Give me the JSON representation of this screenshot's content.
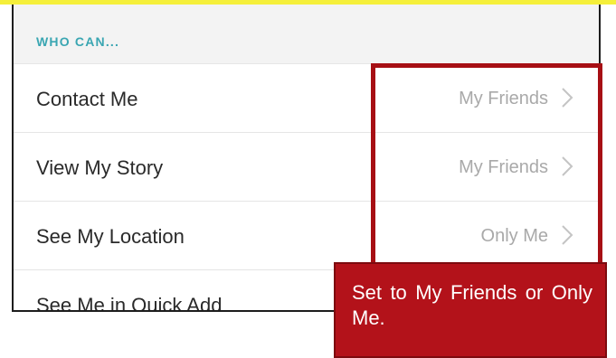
{
  "section": {
    "header": "WHO CAN..."
  },
  "rows": [
    {
      "label": "Contact Me",
      "value": "My Friends"
    },
    {
      "label": "View My Story",
      "value": "My Friends"
    },
    {
      "label": "See My Location",
      "value": "Only Me"
    },
    {
      "label": "See Me in Quick Add",
      "value": ""
    }
  ],
  "callout": {
    "text": "Set to My Friends or Only Me."
  },
  "icons": {
    "row_chevron": "chevron-right-icon"
  },
  "colors": {
    "header_accent": "#3aa6b2",
    "highlight_border": "#a70f14",
    "callout_background": "#b3121a",
    "top_strip": "#f5ef3a"
  }
}
